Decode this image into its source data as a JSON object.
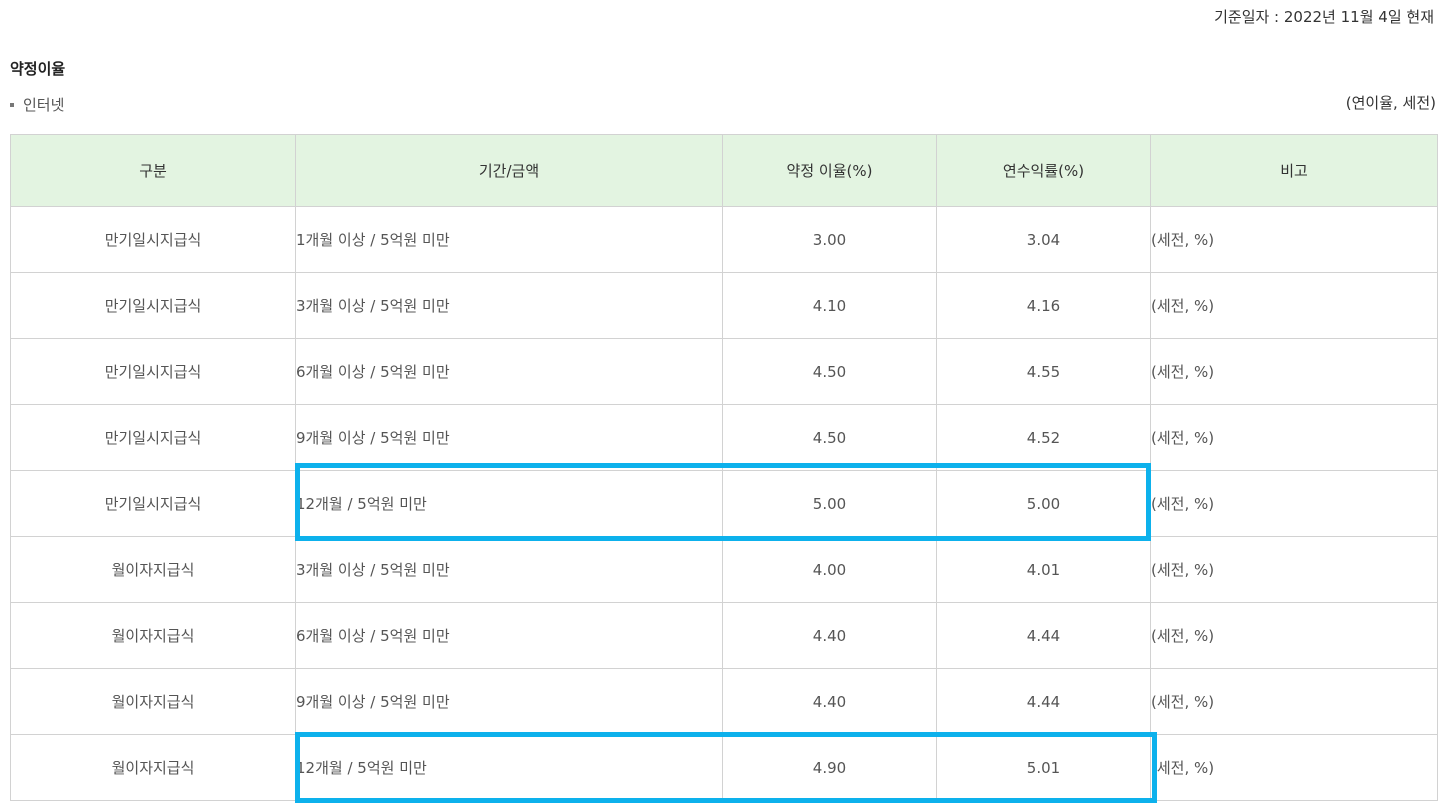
{
  "header": {
    "reference_date": "기준일자 : 2022년 11월 4일 현재"
  },
  "section": {
    "title": "약정이율",
    "subtitle": "인터넷",
    "unit_note": "(연이율, 세전)"
  },
  "table": {
    "headers": [
      "구분",
      "기간/금액",
      "약정 이율(%)",
      "연수익률(%)",
      "비고"
    ],
    "rows": [
      {
        "type": "만기일시지급식",
        "period": "1개월 이상 / 5억원 미만",
        "rate": "3.00",
        "yield": "3.04",
        "note": "(세전, %)"
      },
      {
        "type": "만기일시지급식",
        "period": "3개월 이상 / 5억원 미만",
        "rate": "4.10",
        "yield": "4.16",
        "note": "(세전, %)"
      },
      {
        "type": "만기일시지급식",
        "period": "6개월 이상 / 5억원 미만",
        "rate": "4.50",
        "yield": "4.55",
        "note": "(세전, %)"
      },
      {
        "type": "만기일시지급식",
        "period": "9개월 이상 / 5억원 미만",
        "rate": "4.50",
        "yield": "4.52",
        "note": "(세전, %)"
      },
      {
        "type": "만기일시지급식",
        "period": "12개월 / 5억원 미만",
        "rate": "5.00",
        "yield": "5.00",
        "note": "(세전, %)"
      },
      {
        "type": "월이자지급식",
        "period": "3개월 이상 / 5억원 미만",
        "rate": "4.00",
        "yield": "4.01",
        "note": "(세전, %)"
      },
      {
        "type": "월이자지급식",
        "period": "6개월 이상 / 5억원 미만",
        "rate": "4.40",
        "yield": "4.44",
        "note": "(세전, %)"
      },
      {
        "type": "월이자지급식",
        "period": "9개월 이상 / 5억원 미만",
        "rate": "4.40",
        "yield": "4.44",
        "note": "(세전, %)"
      },
      {
        "type": "월이자지급식",
        "period": "12개월 / 5억원 미만",
        "rate": "4.90",
        "yield": "5.01",
        "note": "(세전, %)"
      }
    ]
  },
  "colors": {
    "header_background": "#e3f4e1",
    "highlight_border": "#0db1ec",
    "grid_line": "#d2d2d2"
  }
}
